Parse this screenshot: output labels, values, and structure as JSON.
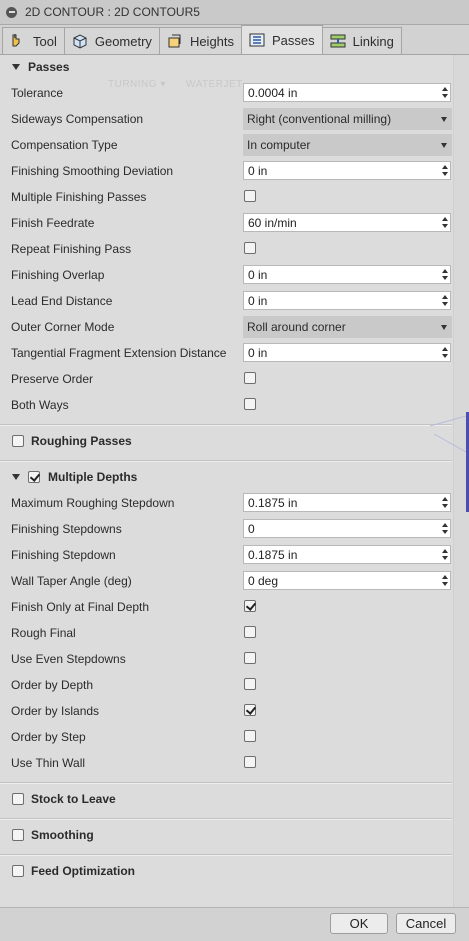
{
  "window": {
    "title": "2D CONTOUR : 2D CONTOUR5"
  },
  "tabs": [
    {
      "label": "Tool",
      "icon": "tool-icon"
    },
    {
      "label": "Geometry",
      "icon": "geometry-icon"
    },
    {
      "label": "Heights",
      "icon": "heights-icon"
    },
    {
      "label": "Passes",
      "icon": "passes-icon",
      "active": true
    },
    {
      "label": "Linking",
      "icon": "linking-icon"
    }
  ],
  "ghost_ribbon": {
    "turning": "TURNING ▾",
    "waterjet": "WATERJET"
  },
  "passes": {
    "header": "Passes",
    "tolerance": {
      "label": "Tolerance",
      "value": "0.0004 in"
    },
    "sideways_compensation": {
      "label": "Sideways Compensation",
      "value": "Right (conventional milling)"
    },
    "compensation_type": {
      "label": "Compensation Type",
      "value": "In computer"
    },
    "finishing_smoothing_deviation": {
      "label": "Finishing Smoothing Deviation",
      "value": "0 in"
    },
    "multiple_finishing_passes": {
      "label": "Multiple Finishing Passes",
      "checked": false
    },
    "finish_feedrate": {
      "label": "Finish Feedrate",
      "value": "60 in/min"
    },
    "repeat_finishing_pass": {
      "label": "Repeat Finishing Pass",
      "checked": false
    },
    "finishing_overlap": {
      "label": "Finishing Overlap",
      "value": "0 in"
    },
    "lead_end_distance": {
      "label": "Lead End Distance",
      "value": "0 in"
    },
    "outer_corner_mode": {
      "label": "Outer Corner Mode",
      "value": "Roll around corner"
    },
    "tangential_fragment": {
      "label": "Tangential Fragment Extension Distance",
      "value": "0 in"
    },
    "preserve_order": {
      "label": "Preserve Order",
      "checked": false
    },
    "both_ways": {
      "label": "Both Ways",
      "checked": false
    }
  },
  "roughing_passes": {
    "label": "Roughing Passes",
    "checked": false
  },
  "multiple_depths": {
    "label": "Multiple Depths",
    "checked": true,
    "max_roughing_stepdown": {
      "label": "Maximum Roughing Stepdown",
      "value": "0.1875 in"
    },
    "finishing_stepdowns": {
      "label": "Finishing Stepdowns",
      "value": "0"
    },
    "finishing_stepdown": {
      "label": "Finishing Stepdown",
      "value": "0.1875 in"
    },
    "wall_taper_angle": {
      "label": "Wall Taper Angle (deg)",
      "value": "0 deg"
    },
    "finish_only_final_depth": {
      "label": "Finish Only at Final Depth",
      "checked": true
    },
    "rough_final": {
      "label": "Rough Final",
      "checked": false
    },
    "use_even_stepdowns": {
      "label": "Use Even Stepdowns",
      "checked": false
    },
    "order_by_depth": {
      "label": "Order by Depth",
      "checked": false
    },
    "order_by_islands": {
      "label": "Order by Islands",
      "checked": true
    },
    "order_by_step": {
      "label": "Order by Step",
      "checked": false
    },
    "use_thin_wall": {
      "label": "Use Thin Wall",
      "checked": false
    }
  },
  "stock_to_leave": {
    "label": "Stock to Leave",
    "checked": false
  },
  "smoothing": {
    "label": "Smoothing",
    "checked": false
  },
  "feed_optimization": {
    "label": "Feed Optimization",
    "checked": false
  },
  "footer": {
    "ok": "OK",
    "cancel": "Cancel"
  }
}
